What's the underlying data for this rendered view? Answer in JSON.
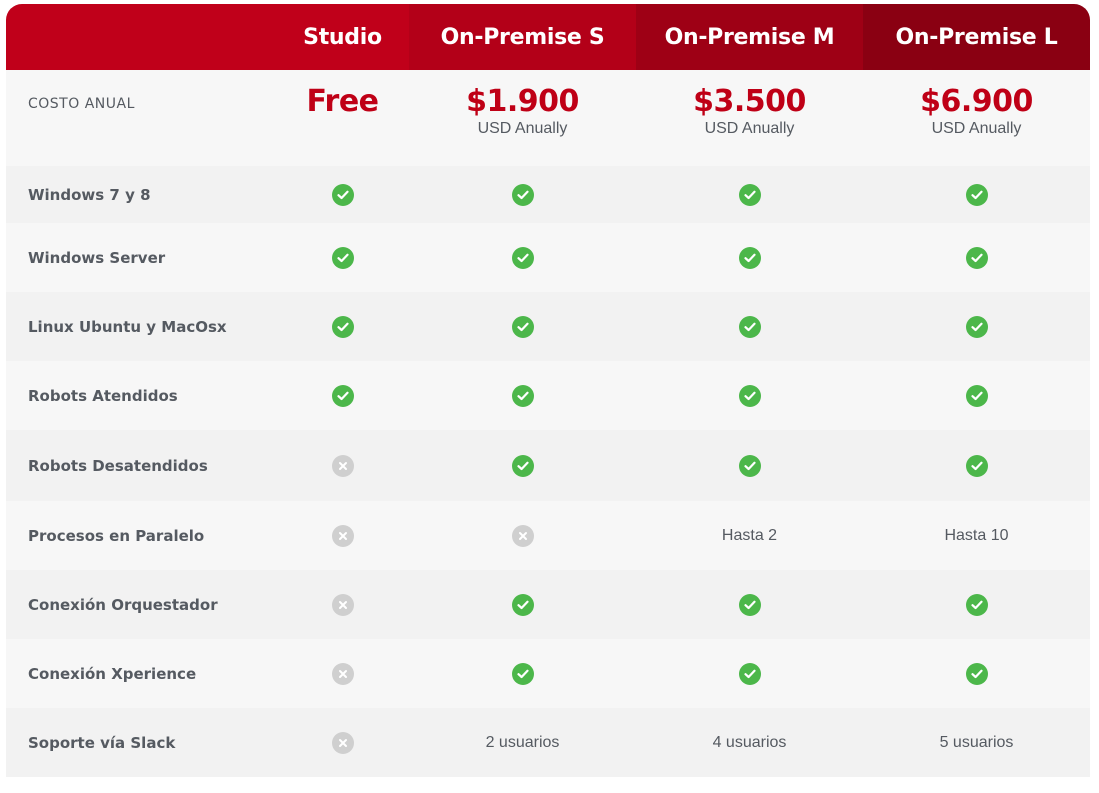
{
  "plans": [
    {
      "name": "Studio",
      "header_color": "#c0001a",
      "price": "Free",
      "price_sub": ""
    },
    {
      "name": "On-Premise S",
      "header_color": "#b30018",
      "price": "$1.900",
      "price_sub": "USD Anually"
    },
    {
      "name": "On-Premise M",
      "header_color": "#9e0015",
      "price": "$3.500",
      "price_sub": "USD Anually"
    },
    {
      "name": "On-Premise L",
      "header_color": "#8a0012",
      "price": "$6.900",
      "price_sub": "USD Anually"
    }
  ],
  "header_label_color": "#c0001a",
  "price_label": "COSTO ANUAL",
  "features": [
    {
      "label": "Windows 7 y 8",
      "values": [
        "check",
        "check",
        "check",
        "check"
      ]
    },
    {
      "label": "Windows Server",
      "values": [
        "check",
        "check",
        "check",
        "check"
      ]
    },
    {
      "label": "Linux Ubuntu y MacOsx",
      "values": [
        "check",
        "check",
        "check",
        "check"
      ]
    },
    {
      "label": "Robots Atendidos",
      "values": [
        "check",
        "check",
        "check",
        "check"
      ]
    },
    {
      "label": "Robots Desatendidos",
      "values": [
        "cross",
        "check",
        "check",
        "check"
      ]
    },
    {
      "label": "Procesos en Paralelo",
      "values": [
        "cross",
        "cross",
        "Hasta 2",
        "Hasta 10"
      ]
    },
    {
      "label": "Conexión Orquestador",
      "values": [
        "cross",
        "check",
        "check",
        "check"
      ]
    },
    {
      "label": "Conexión Xperience",
      "values": [
        "cross",
        "check",
        "check",
        "check"
      ]
    },
    {
      "label": "Soporte vía Slack",
      "values": [
        "cross",
        "2 usuarios",
        "4 usuarios",
        "5 usuarios"
      ]
    }
  ],
  "icons": {
    "check": "check-circle-icon",
    "cross": "x-circle-icon"
  },
  "colors": {
    "price": "#bf0016",
    "check": "#4cb74a",
    "cross": "#cfcfcf",
    "text": "#555a61"
  }
}
